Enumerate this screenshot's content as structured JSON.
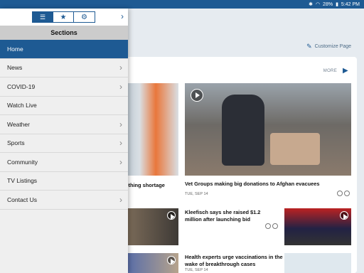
{
  "status": {
    "battery": "28%",
    "time": "5:42 PM"
  },
  "drawer": {
    "title": "Sections",
    "items": [
      {
        "label": "Home",
        "active": true,
        "has_arrow": false
      },
      {
        "label": "News",
        "has_arrow": true
      },
      {
        "label": "COVID-19",
        "has_arrow": true
      },
      {
        "label": "Watch Live",
        "has_arrow": false
      },
      {
        "label": "Weather",
        "has_arrow": true
      },
      {
        "label": "Sports",
        "has_arrow": true
      },
      {
        "label": "Community",
        "has_arrow": true
      },
      {
        "label": "TV Listings",
        "has_arrow": false
      },
      {
        "label": "Contact Us",
        "has_arrow": true
      }
    ]
  },
  "toolbar": {
    "customize_label": "Customize Page"
  },
  "feed": {
    "more_label": "MORE",
    "partial_headline": "othing shortage",
    "main": {
      "headline": "Vet Groups making big donations to Afghan evacuees",
      "date": "TUE, SEP 14"
    },
    "story2": {
      "headline": "Kleefisch says she raised $1.2 million after launching bid"
    },
    "story3": {
      "headline": "Health experts urge vaccinations in the wake of breakthrough cases",
      "date": "TUE, SEP 14"
    }
  },
  "colors": {
    "accent": "#1e5a93"
  }
}
